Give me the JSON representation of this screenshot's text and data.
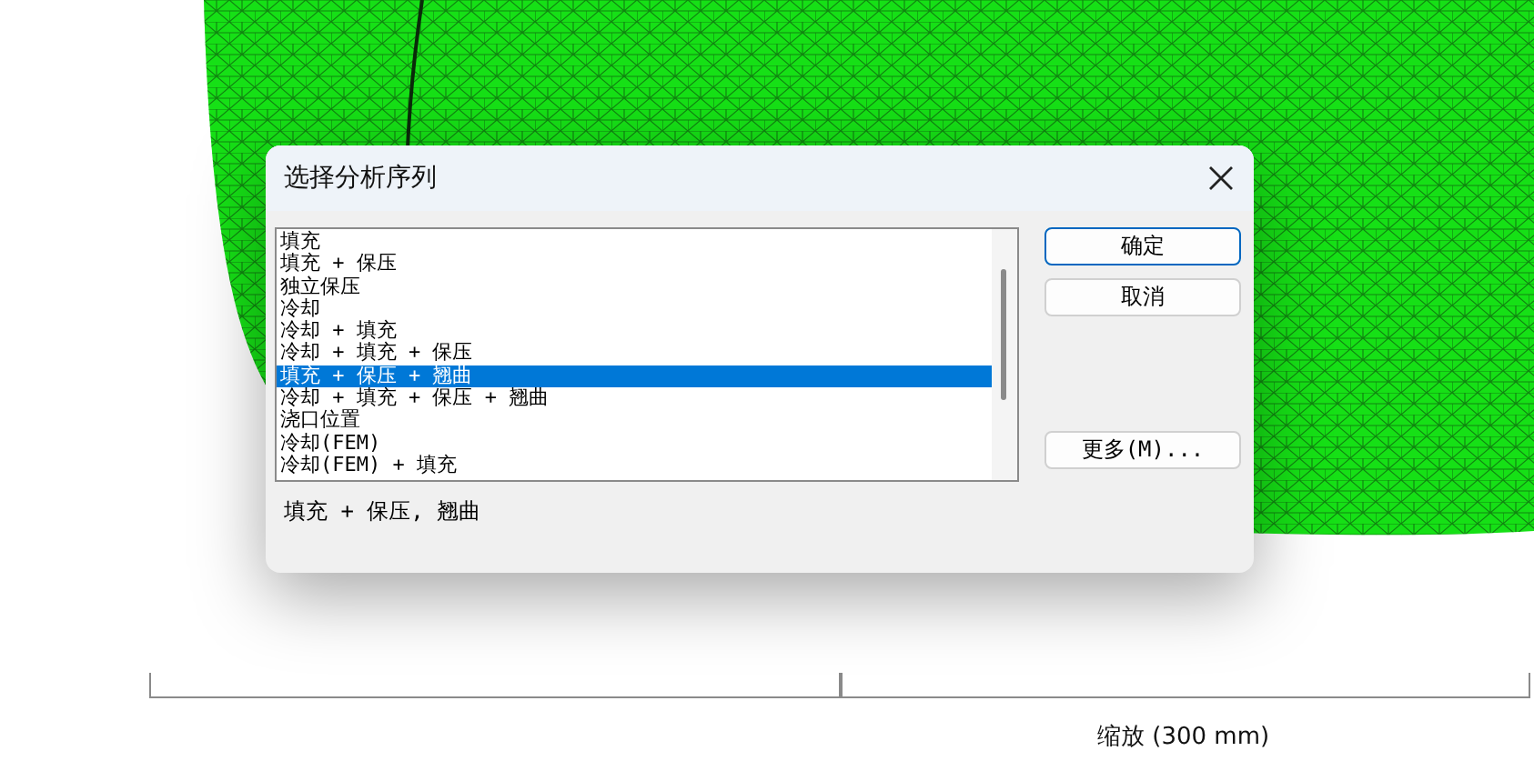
{
  "dialog": {
    "title": "选择分析序列",
    "list": [
      {
        "label": "填充",
        "selected": false
      },
      {
        "label": "填充 + 保压",
        "selected": false
      },
      {
        "label": "独立保压",
        "selected": false
      },
      {
        "label": "冷却",
        "selected": false
      },
      {
        "label": "冷却 + 填充",
        "selected": false
      },
      {
        "label": "冷却 + 填充 + 保压",
        "selected": false
      },
      {
        "label": "填充 + 保压 + 翘曲",
        "selected": true
      },
      {
        "label": "冷却 + 填充 + 保压 + 翘曲",
        "selected": false
      },
      {
        "label": "浇口位置",
        "selected": false
      },
      {
        "label": "冷却(FEM)",
        "selected": false
      },
      {
        "label": "冷却(FEM) + 填充",
        "selected": false
      }
    ],
    "buttons": [
      {
        "label": "确定",
        "default": true
      },
      {
        "label": "取消",
        "default": false
      },
      {
        "label": "更多(M)...",
        "default": false
      }
    ],
    "description": "填充 + 保压, 翘曲"
  },
  "scale_bar": {
    "label": "缩放 (300 mm)"
  }
}
